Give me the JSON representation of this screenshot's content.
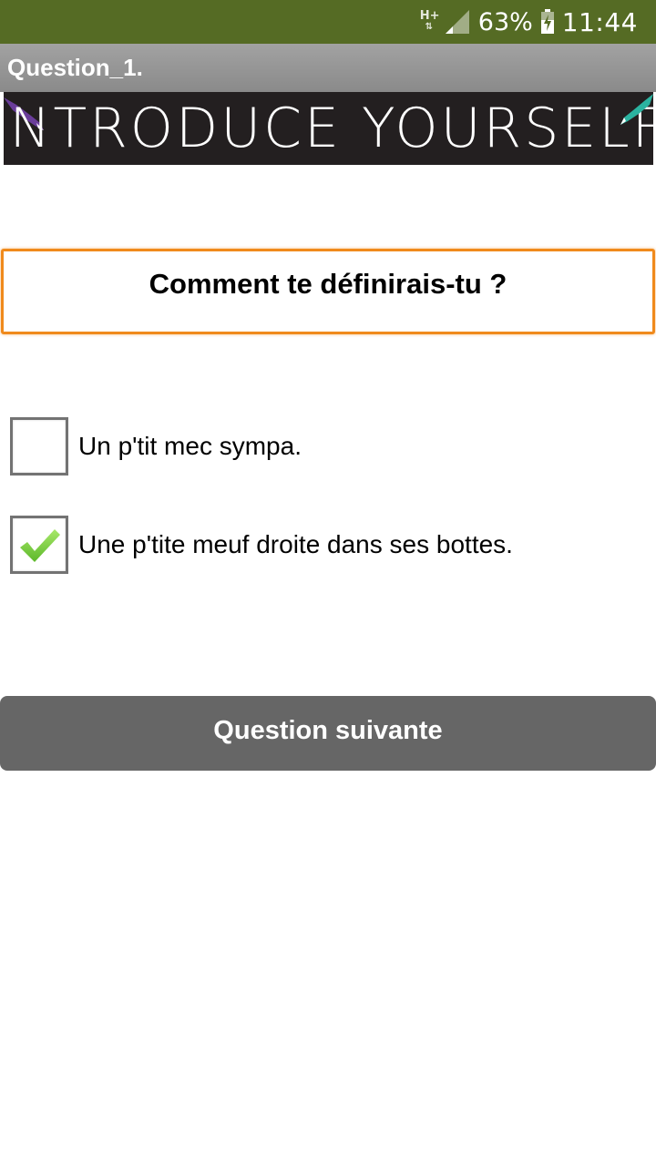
{
  "status_bar": {
    "network_type": "H+",
    "battery_percent": "63%",
    "time": "11:44"
  },
  "title_bar": {
    "title": "Question_1."
  },
  "banner": {
    "text": "INTRODUCE YOURSELF",
    "pen_colors": [
      "#6a3d9a",
      "#2bb3a0"
    ]
  },
  "question": {
    "text": "Comment te définirais-tu ?",
    "border_color": "#f08a1c"
  },
  "options": [
    {
      "label": "Un p'tit mec sympa.",
      "checked": false
    },
    {
      "label": "Une p'tite meuf droite dans ses bottes.",
      "checked": true
    }
  ],
  "next_button": {
    "label": "Question suivante"
  },
  "colors": {
    "status_bar": "#556b24",
    "title_bar": "#9a9a9a",
    "button": "#666666",
    "check": "#7ccf3a"
  }
}
